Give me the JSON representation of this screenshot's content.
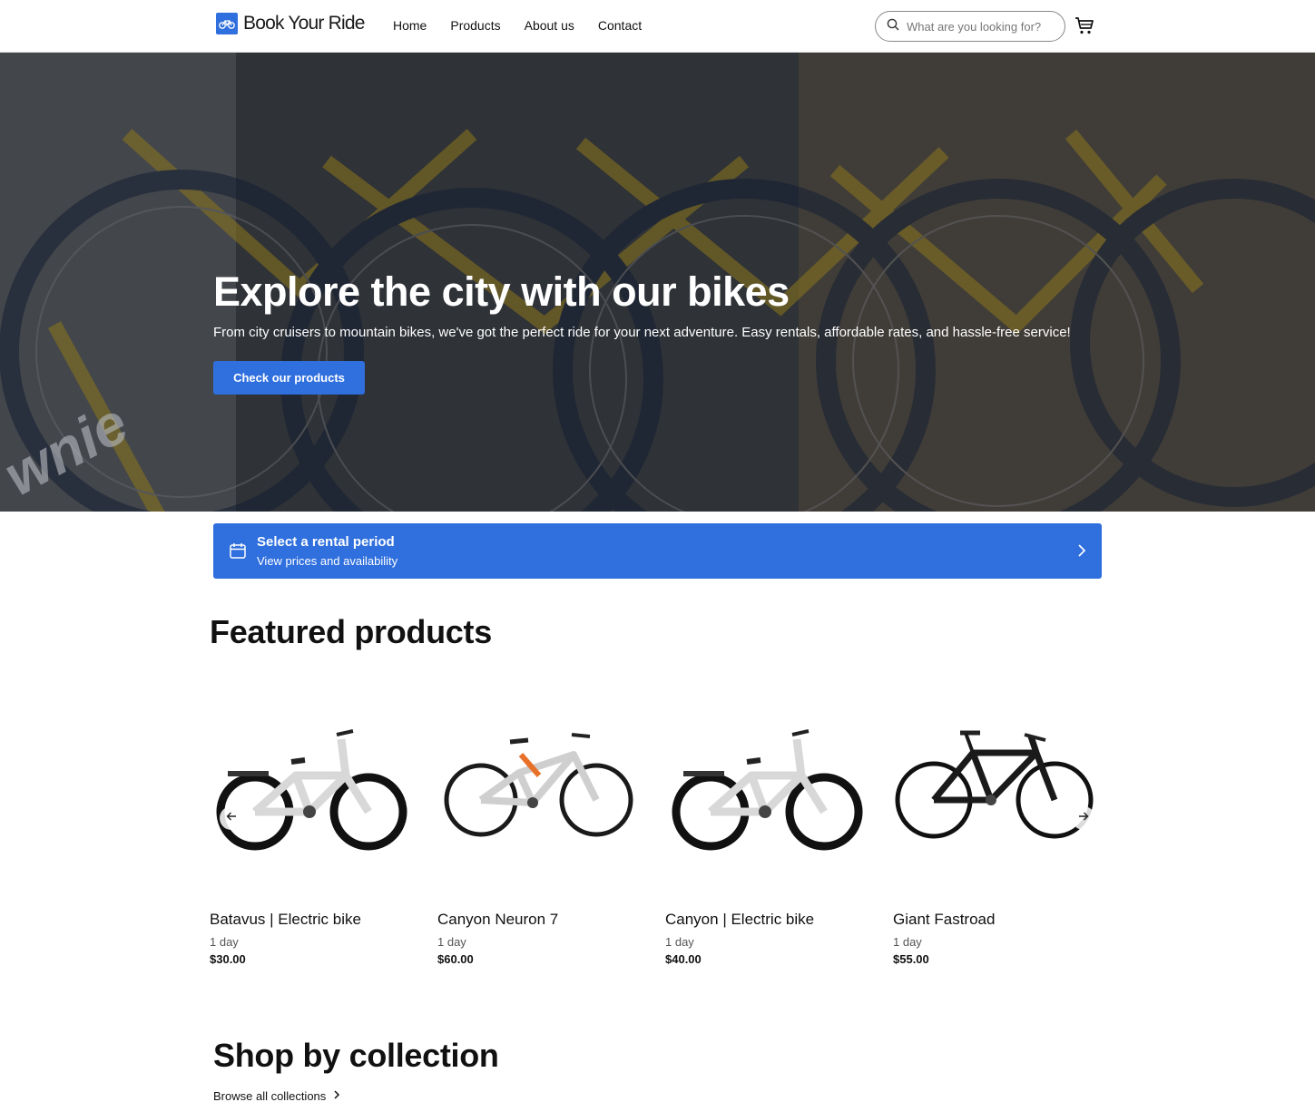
{
  "header": {
    "logo_text": "Book Your Ride",
    "nav": [
      "Home",
      "Products",
      "About us",
      "Contact"
    ],
    "search_placeholder": "What are you looking for?"
  },
  "hero": {
    "title": "Explore the city with our bikes",
    "subtitle": "From city cruisers to mountain bikes, we've got the perfect ride for your next adventure. Easy rentals, affordable rates, and hassle-free service!",
    "cta_label": "Check our products",
    "photo_text": "wnie"
  },
  "rental_bar": {
    "title": "Select a rental period",
    "subtitle": "View prices and availability"
  },
  "featured": {
    "title": "Featured products",
    "products": [
      {
        "name": "Batavus | Electric bike",
        "duration": "1 day",
        "price": "$30.00",
        "image": "white-e-bike-icon"
      },
      {
        "name": "Canyon Neuron 7",
        "duration": "1 day",
        "price": "$60.00",
        "image": "white-mtb-icon"
      },
      {
        "name": "Canyon | Electric bike",
        "duration": "1 day",
        "price": "$40.00",
        "image": "white-e-bike-icon"
      },
      {
        "name": "Giant Fastroad",
        "duration": "1 day",
        "price": "$55.00",
        "image": "black-road-bike-icon"
      }
    ]
  },
  "collections": {
    "title": "Shop by collection",
    "browse_label": "Browse all collections"
  },
  "colors": {
    "accent": "#2f6fde",
    "text": "#111111"
  }
}
